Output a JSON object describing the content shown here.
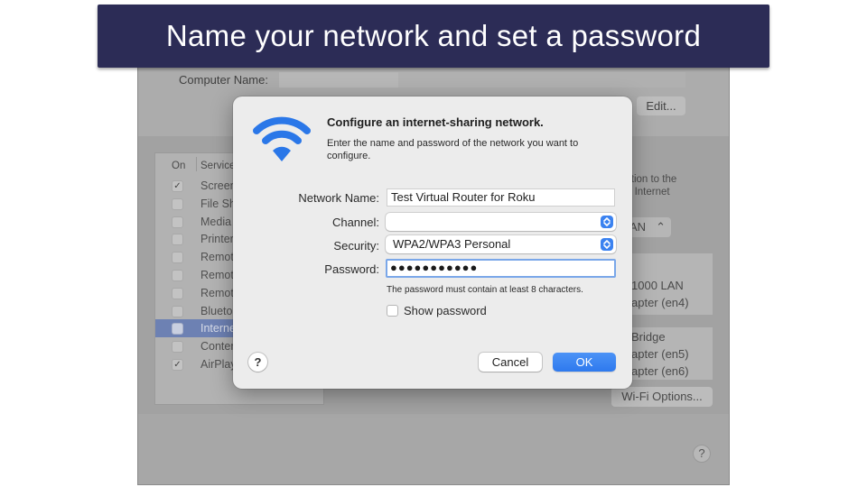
{
  "banner": {
    "title": "Name your network and set a password"
  },
  "background_window": {
    "computer_name_label": "Computer Name:",
    "edit_button": "Edit...",
    "services_header": {
      "on": "On",
      "service": "Service"
    },
    "services": [
      {
        "label": "Screen",
        "checked": true,
        "selected": false
      },
      {
        "label": "File Sh",
        "checked": false,
        "selected": false
      },
      {
        "label": "Media",
        "checked": false,
        "selected": false
      },
      {
        "label": "Printer",
        "checked": false,
        "selected": false
      },
      {
        "label": "Remot",
        "checked": false,
        "selected": false
      },
      {
        "label": "Remot",
        "checked": false,
        "selected": false
      },
      {
        "label": "Remot",
        "checked": false,
        "selected": false
      },
      {
        "label": "Blueto",
        "checked": false,
        "selected": false
      },
      {
        "label": "Interne",
        "checked": false,
        "selected": true
      },
      {
        "label": "Conter",
        "checked": false,
        "selected": false
      },
      {
        "label": "AirPlay",
        "checked": true,
        "selected": false
      }
    ],
    "right_text_1": "ction to the",
    "right_text_2": "e Internet",
    "right_popup": "AN",
    "interfaces": [
      "1000 LAN",
      "apter (en4)",
      "Bridge",
      "apter (en5)",
      "apter (en6)"
    ],
    "wifi_options_button": "Wi-Fi Options...",
    "help_button": "?"
  },
  "dialog": {
    "title": "Configure an internet-sharing network.",
    "description": "Enter the name and password of the network you want to configure.",
    "network_name_label": "Network Name:",
    "network_name_value": "Test Virtual Router for Roku",
    "channel_label": "Channel:",
    "channel_value": "",
    "security_label": "Security:",
    "security_value": "WPA2/WPA3 Personal",
    "password_label": "Password:",
    "password_value": "●●●●●●●●●●●",
    "password_hint": "The password must contain at least 8 characters.",
    "show_password_label": "Show password",
    "show_password_checked": false,
    "help_button": "?",
    "cancel_button": "Cancel",
    "ok_button": "OK",
    "accent_color": "#2f7bf0",
    "icon": "wifi-icon"
  },
  "colors": {
    "banner_bg": "#2c2c56",
    "banner_text": "#ffffff",
    "wifi_icon": "#2a77e8"
  }
}
